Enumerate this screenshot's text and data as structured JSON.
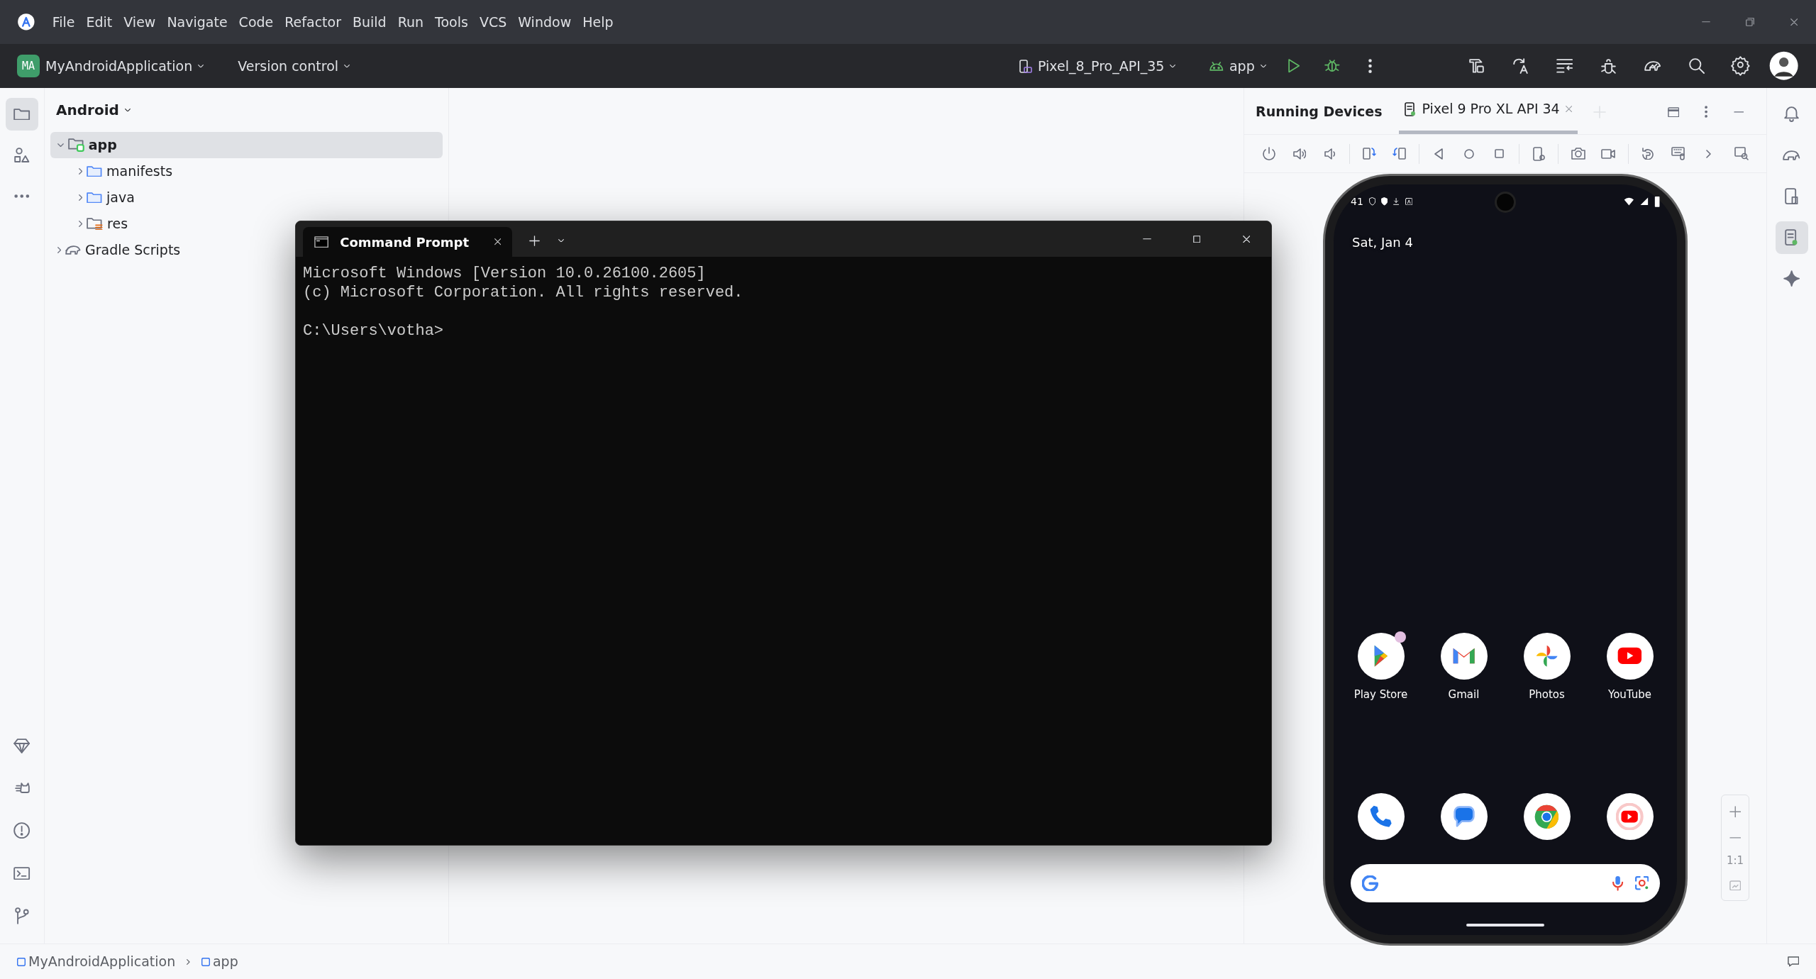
{
  "menu": [
    "File",
    "Edit",
    "View",
    "Navigate",
    "Code",
    "Refactor",
    "Build",
    "Run",
    "Tools",
    "VCS",
    "Window",
    "Help"
  ],
  "project": {
    "initials": "MA",
    "name": "MyAndroidApplication"
  },
  "vcs": "Version control",
  "device_selector": "Pixel_8_Pro_API_35",
  "run_config": "app",
  "left_tools": [
    {
      "kind": "folder",
      "selected": true
    },
    {
      "kind": "shapes",
      "selected": false
    },
    {
      "kind": "more",
      "selected": false
    }
  ],
  "project_view": {
    "title": "Android",
    "tree": [
      {
        "label": "app",
        "kind": "module",
        "expanded": true,
        "selected": true,
        "children": [
          {
            "label": "manifests",
            "kind": "folder",
            "expanded": false,
            "selected": false
          },
          {
            "label": "java",
            "kind": "folder",
            "expanded": false,
            "selected": false
          },
          {
            "label": "res",
            "kind": "res",
            "expanded": false,
            "selected": false
          }
        ]
      },
      {
        "label": "Gradle Scripts",
        "kind": "gradle",
        "expanded": false,
        "selected": false
      }
    ]
  },
  "terminal": {
    "tab_title": "Command Prompt",
    "banner": [
      "Microsoft Windows [Version 10.0.26100.2605]",
      "(c) Microsoft Corporation. All rights reserved."
    ],
    "prompt": "C:\\Users\\votha>"
  },
  "running_devices": {
    "title": "Running Devices",
    "tabs": [
      {
        "label": "Pixel 9 Pro XL API 34",
        "selected": true
      }
    ]
  },
  "phone": {
    "status_time": "41",
    "date": "Sat, Jan 4",
    "apps": [
      {
        "label": "Play Store",
        "kind": "playstore",
        "notification_dot": true
      },
      {
        "label": "Gmail",
        "kind": "gmail",
        "notification_dot": false
      },
      {
        "label": "Photos",
        "kind": "photos",
        "notification_dot": false
      },
      {
        "label": "YouTube",
        "kind": "youtube",
        "notification_dot": false
      }
    ],
    "dock": [
      {
        "kind": "phone"
      },
      {
        "kind": "messages"
      },
      {
        "kind": "chrome"
      },
      {
        "kind": "ytmusic"
      }
    ]
  },
  "zoom": {
    "reset_label": "1:1"
  },
  "right_tools": [
    {
      "kind": "bell",
      "selected": false
    },
    {
      "kind": "elephant",
      "selected": false
    },
    {
      "kind": "device-file",
      "selected": false
    },
    {
      "kind": "running-devices",
      "selected": true
    },
    {
      "kind": "sparkle",
      "selected": false
    }
  ],
  "breadcrumbs": [
    "MyAndroidApplication",
    "app"
  ]
}
